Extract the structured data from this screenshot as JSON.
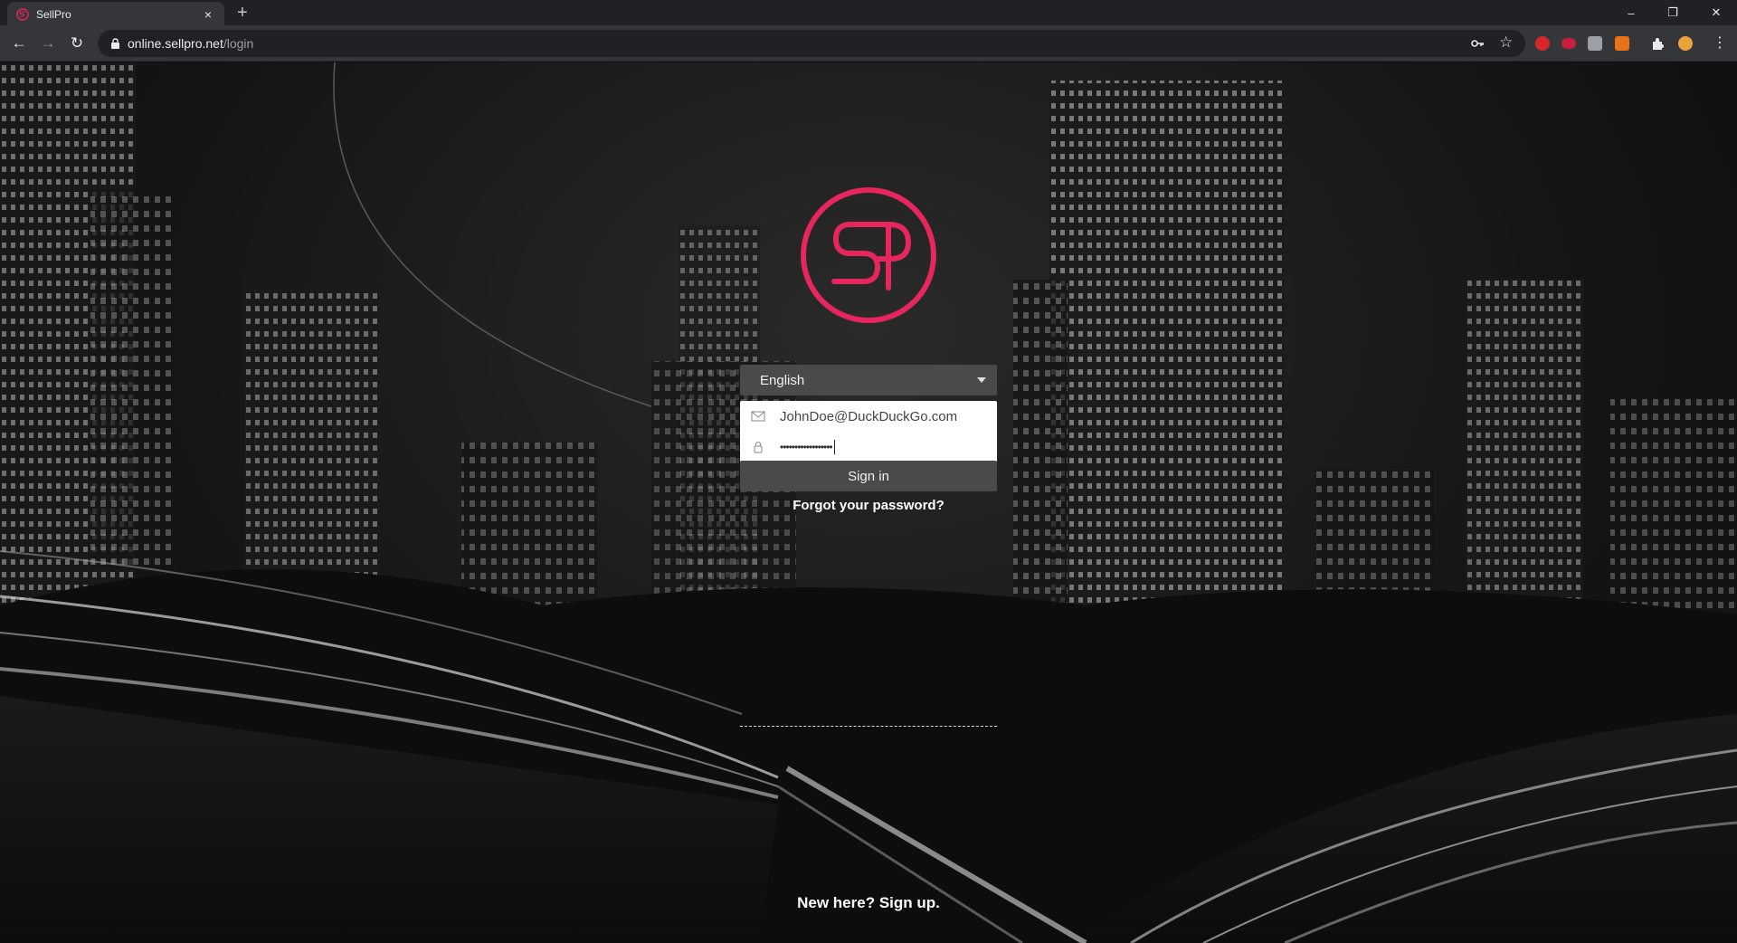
{
  "browser": {
    "tab_title": "SellPro",
    "tab_close": "×",
    "new_tab": "+",
    "url_host": "online.sellpro.net",
    "url_path": "/login",
    "window_controls": {
      "minimize": "–",
      "restore": "❐",
      "close": "✕"
    },
    "nav": {
      "back": "←",
      "forward": "→",
      "reload": "↻"
    },
    "omnibox_icons": {
      "key": "key-icon",
      "star": "☆"
    }
  },
  "brand": {
    "accent": "#e8265e",
    "logo_text": "SP"
  },
  "login": {
    "language_selected": "English",
    "email_value": "JohnDoe@DuckDuckGo.com",
    "password_mask": "••••••••••••••••••",
    "signin_label": "Sign in",
    "forgot_label": "Forgot your password?",
    "signup_label": "New here? Sign up."
  }
}
